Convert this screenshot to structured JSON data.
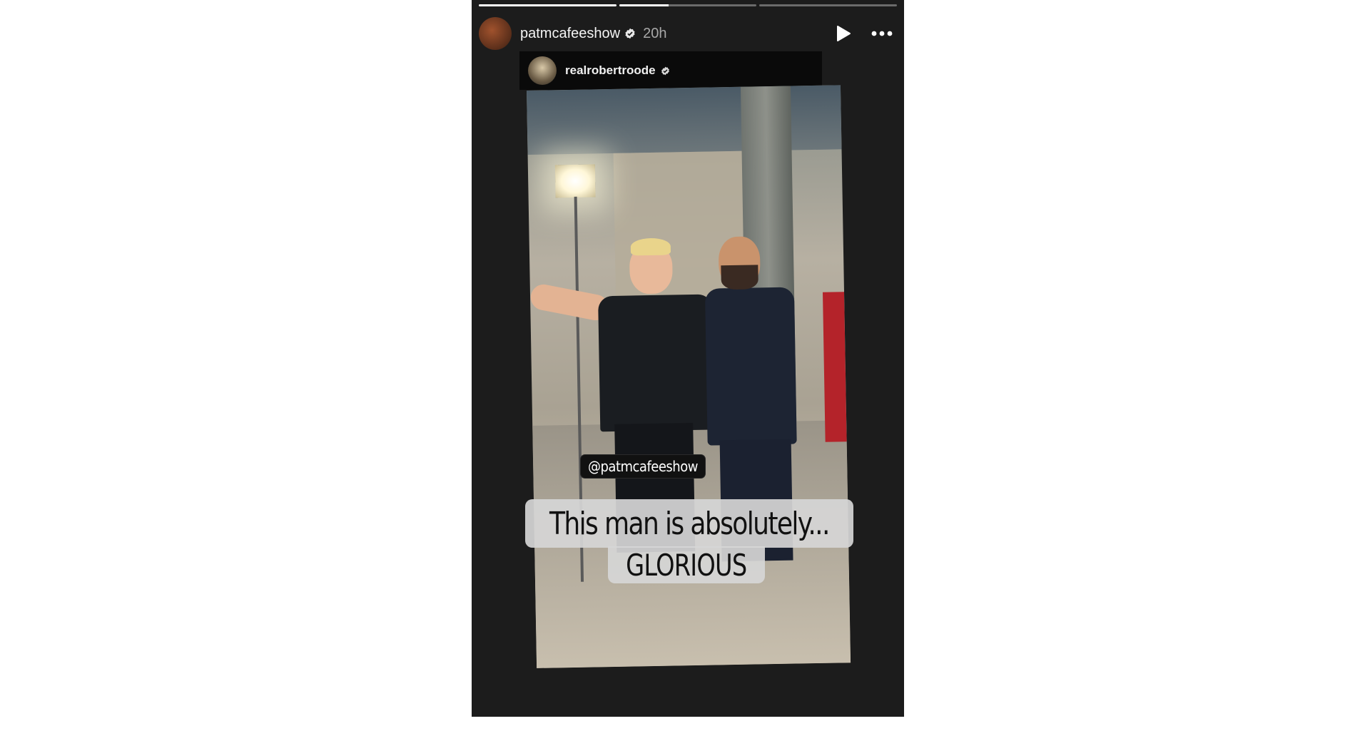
{
  "progress": {
    "segments": 3,
    "fills": [
      1.0,
      0.36,
      0.0
    ]
  },
  "header": {
    "username": "patmcafeeshow",
    "time": "20h",
    "verified_icon": "verified-badge-icon",
    "play_icon": "play-icon",
    "more_icon": "more-options-icon"
  },
  "reshare": {
    "username": "realrobertroode"
  },
  "photo": {
    "mention": "@patmcafeeshow",
    "caption_line1": "This man is absolutely...",
    "caption_line2": "GLORIOUS"
  },
  "colors": {
    "story_bg": "#1c1c1c",
    "text": "#f5f5f5",
    "muted": "#a8a8a8",
    "caption_bg": "#d6d6d6"
  }
}
